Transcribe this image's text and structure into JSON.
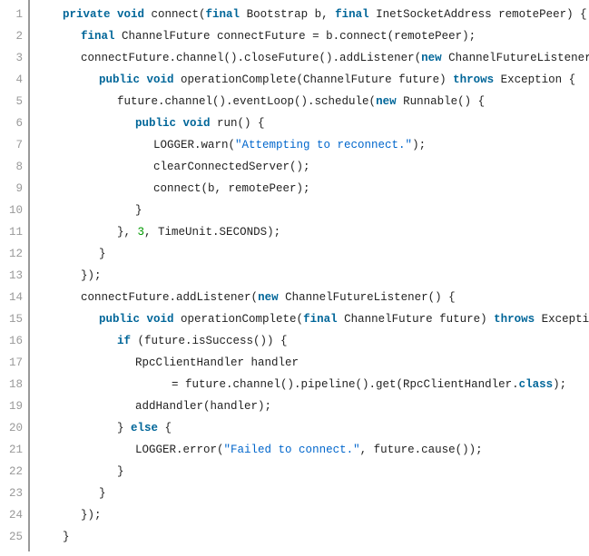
{
  "chart_data": {
    "type": "table",
    "title": "Java code snippet",
    "language": "java",
    "lines": [
      {
        "n": 1,
        "indent": 1,
        "tokens": [
          {
            "t": "private void",
            "c": "kw"
          },
          {
            "t": " connect(",
            "c": "plain"
          },
          {
            "t": "final",
            "c": "kw"
          },
          {
            "t": " Bootstrap b, ",
            "c": "plain"
          },
          {
            "t": "final",
            "c": "kw"
          },
          {
            "t": " InetSocketAddress remotePeer) {",
            "c": "plain"
          }
        ]
      },
      {
        "n": 2,
        "indent": 2,
        "tokens": [
          {
            "t": "final",
            "c": "kw"
          },
          {
            "t": " ChannelFuture connectFuture = b.connect(remotePeer);",
            "c": "plain"
          }
        ]
      },
      {
        "n": 3,
        "indent": 2,
        "tokens": [
          {
            "t": "connectFuture.channel().closeFuture().addListener(",
            "c": "plain"
          },
          {
            "t": "new",
            "c": "kw"
          },
          {
            "t": " ChannelFutureListener() {",
            "c": "plain"
          }
        ]
      },
      {
        "n": 4,
        "indent": 3,
        "tokens": [
          {
            "t": "public void",
            "c": "kw"
          },
          {
            "t": " operationComplete(ChannelFuture future) ",
            "c": "plain"
          },
          {
            "t": "throws",
            "c": "kw"
          },
          {
            "t": " Exception {",
            "c": "plain"
          }
        ]
      },
      {
        "n": 5,
        "indent": 4,
        "tokens": [
          {
            "t": "future.channel().eventLoop().schedule(",
            "c": "plain"
          },
          {
            "t": "new",
            "c": "kw"
          },
          {
            "t": " Runnable() {",
            "c": "plain"
          }
        ]
      },
      {
        "n": 6,
        "indent": 5,
        "tokens": [
          {
            "t": "public void",
            "c": "kw"
          },
          {
            "t": " run() {",
            "c": "plain"
          }
        ]
      },
      {
        "n": 7,
        "indent": 6,
        "tokens": [
          {
            "t": "LOGGER.warn(",
            "c": "plain"
          },
          {
            "t": "\"Attempting to reconnect.\"",
            "c": "str"
          },
          {
            "t": ");",
            "c": "plain"
          }
        ]
      },
      {
        "n": 8,
        "indent": 6,
        "tokens": [
          {
            "t": "clearConnectedServer();",
            "c": "plain"
          }
        ]
      },
      {
        "n": 9,
        "indent": 6,
        "tokens": [
          {
            "t": "connect(b, remotePeer);",
            "c": "plain"
          }
        ]
      },
      {
        "n": 10,
        "indent": 5,
        "tokens": [
          {
            "t": "}",
            "c": "plain"
          }
        ]
      },
      {
        "n": 11,
        "indent": 4,
        "tokens": [
          {
            "t": "}, ",
            "c": "plain"
          },
          {
            "t": "3",
            "c": "num"
          },
          {
            "t": ", TimeUnit.SECONDS);",
            "c": "plain"
          }
        ]
      },
      {
        "n": 12,
        "indent": 3,
        "tokens": [
          {
            "t": "}",
            "c": "plain"
          }
        ]
      },
      {
        "n": 13,
        "indent": 2,
        "tokens": [
          {
            "t": "});",
            "c": "plain"
          }
        ]
      },
      {
        "n": 14,
        "indent": 2,
        "tokens": [
          {
            "t": "connectFuture.addListener(",
            "c": "plain"
          },
          {
            "t": "new",
            "c": "kw"
          },
          {
            "t": " ChannelFutureListener() {",
            "c": "plain"
          }
        ]
      },
      {
        "n": 15,
        "indent": 3,
        "tokens": [
          {
            "t": "public void",
            "c": "kw"
          },
          {
            "t": " operationComplete(",
            "c": "plain"
          },
          {
            "t": "final",
            "c": "kw"
          },
          {
            "t": " ChannelFuture future) ",
            "c": "plain"
          },
          {
            "t": "throws",
            "c": "kw"
          },
          {
            "t": " Exception {",
            "c": "plain"
          }
        ]
      },
      {
        "n": 16,
        "indent": 4,
        "tokens": [
          {
            "t": "if",
            "c": "kw"
          },
          {
            "t": " (future.isSuccess()) {",
            "c": "plain"
          }
        ]
      },
      {
        "n": 17,
        "indent": 5,
        "tokens": [
          {
            "t": "RpcClientHandler handler",
            "c": "plain"
          }
        ]
      },
      {
        "n": 18,
        "indent": 7,
        "tokens": [
          {
            "t": "= future.channel().pipeline().get(RpcClientHandler.",
            "c": "plain"
          },
          {
            "t": "class",
            "c": "kw"
          },
          {
            "t": ");",
            "c": "plain"
          }
        ]
      },
      {
        "n": 19,
        "indent": 5,
        "tokens": [
          {
            "t": "addHandler(handler);",
            "c": "plain"
          }
        ]
      },
      {
        "n": 20,
        "indent": 4,
        "tokens": [
          {
            "t": "} ",
            "c": "plain"
          },
          {
            "t": "else",
            "c": "kw"
          },
          {
            "t": " {",
            "c": "plain"
          }
        ]
      },
      {
        "n": 21,
        "indent": 5,
        "tokens": [
          {
            "t": "LOGGER.error(",
            "c": "plain"
          },
          {
            "t": "\"Failed to connect.\"",
            "c": "str"
          },
          {
            "t": ", future.cause());",
            "c": "plain"
          }
        ]
      },
      {
        "n": 22,
        "indent": 4,
        "tokens": [
          {
            "t": "}",
            "c": "plain"
          }
        ]
      },
      {
        "n": 23,
        "indent": 3,
        "tokens": [
          {
            "t": "}",
            "c": "plain"
          }
        ]
      },
      {
        "n": 24,
        "indent": 2,
        "tokens": [
          {
            "t": "});",
            "c": "plain"
          }
        ]
      },
      {
        "n": 25,
        "indent": 1,
        "tokens": [
          {
            "t": "}",
            "c": "plain"
          }
        ]
      }
    ]
  }
}
